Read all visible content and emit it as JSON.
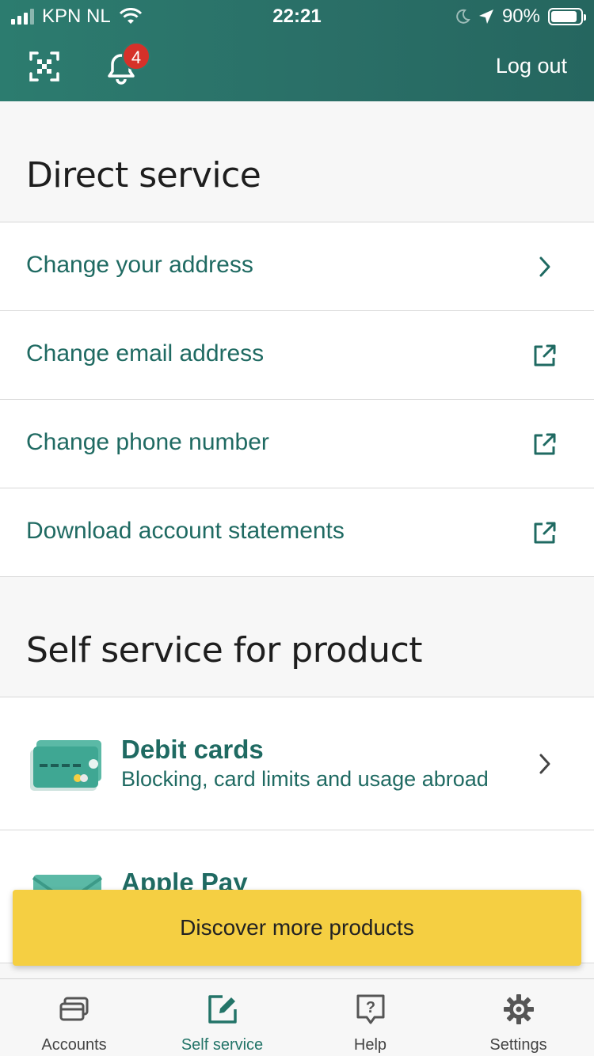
{
  "status_bar": {
    "carrier": "KPN NL",
    "time": "22:21",
    "battery": "90%"
  },
  "header": {
    "notification_count": "4",
    "logout_label": "Log out"
  },
  "direct_service": {
    "title": "Direct service",
    "items": [
      {
        "label": "Change your address",
        "icon": "chevron-right-icon"
      },
      {
        "label": "Change email address",
        "icon": "external-link-icon"
      },
      {
        "label": "Change phone number",
        "icon": "external-link-icon"
      },
      {
        "label": "Download account statements",
        "icon": "external-link-icon"
      }
    ]
  },
  "product_service": {
    "title": "Self service for product",
    "items": [
      {
        "title": "Debit cards",
        "subtitle": "Blocking, card limits and usage abroad",
        "icon": "debit-card-icon"
      },
      {
        "title": "Apple Pay",
        "icon": "apple-pay-icon"
      }
    ]
  },
  "cta": {
    "label": "Discover more products"
  },
  "tabs": [
    {
      "label": "Accounts",
      "icon": "cards-icon"
    },
    {
      "label": "Self service",
      "icon": "edit-icon",
      "active": true
    },
    {
      "label": "Help",
      "icon": "help-icon"
    },
    {
      "label": "Settings",
      "icon": "gear-icon"
    }
  ],
  "colors": {
    "brand": "#2c7c6f",
    "link": "#1f6a62",
    "cta": "#f5cf42",
    "badge": "#d6312a"
  }
}
